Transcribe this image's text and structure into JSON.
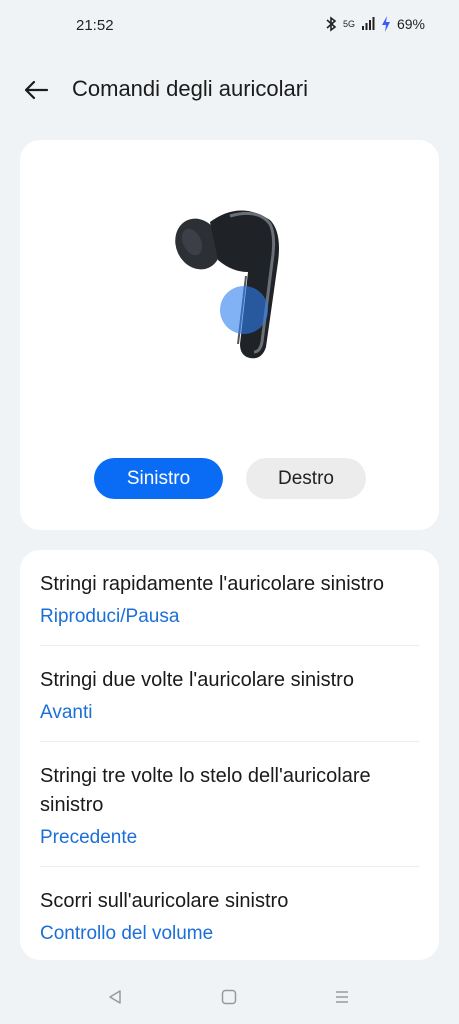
{
  "status": {
    "time": "21:52",
    "battery": "69%",
    "network": "5G"
  },
  "header": {
    "title": "Comandi degli auricolari"
  },
  "toggle": {
    "left_label": "Sinistro",
    "right_label": "Destro",
    "selected": "Sinistro",
    "accent": "#0a6cf5"
  },
  "items": [
    {
      "title": "Stringi rapidamente l'auricolare sinistro",
      "value": "Riproduci/Pausa"
    },
    {
      "title": "Stringi due volte l'auricolare sinistro",
      "value": "Avanti"
    },
    {
      "title": "Stringi tre volte lo stelo dell'auricolare sinistro",
      "value": "Precedente"
    },
    {
      "title": "Scorri sull'auricolare sinistro",
      "value": "Controllo del volume"
    }
  ],
  "nav": {
    "back_icon": "triangle-back-icon",
    "home_icon": "square-home-icon",
    "menu_icon": "menu-lines-icon"
  }
}
